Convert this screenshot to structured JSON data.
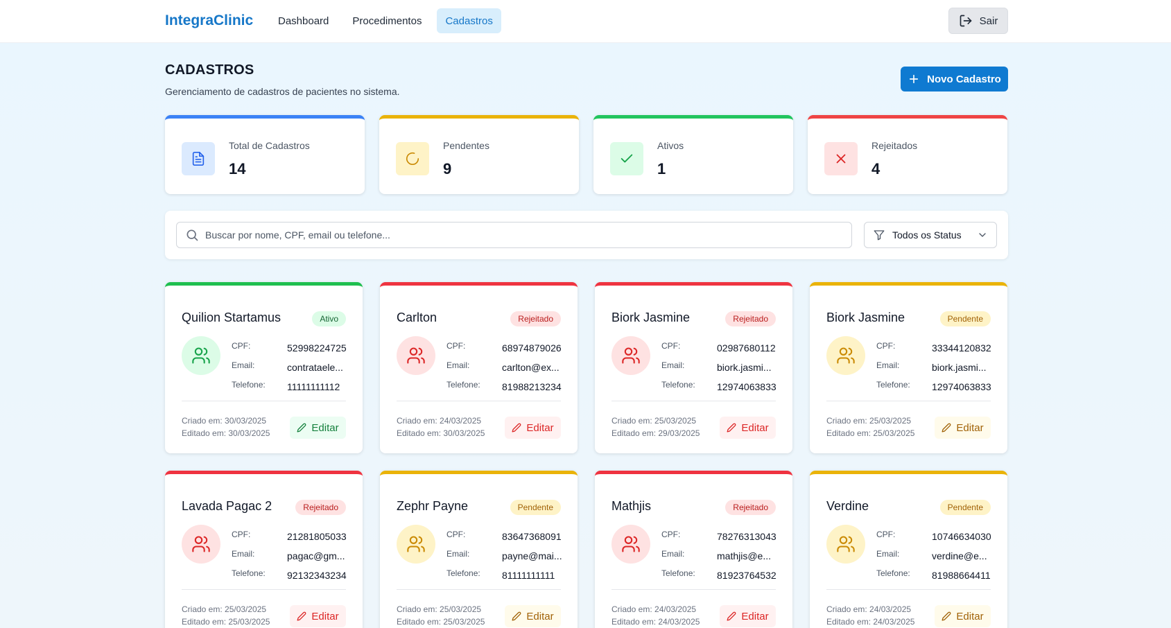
{
  "app": {
    "brand": "IntegraClinic"
  },
  "nav": {
    "items": [
      {
        "label": "Dashboard",
        "active": false
      },
      {
        "label": "Procedimentos",
        "active": false
      },
      {
        "label": "Cadastros",
        "active": true
      }
    ],
    "logout_label": "Sair"
  },
  "header": {
    "title": "CADASTROS",
    "subtitle": "Gerenciamento de cadastros de pacientes no sistema.",
    "new_button_label": "Novo Cadastro"
  },
  "stats": [
    {
      "label": "Total de Cadastros",
      "value": "14",
      "accent": "#3b82f6",
      "icon": "document-icon"
    },
    {
      "label": "Pendentes",
      "value": "9",
      "accent": "#eab308",
      "icon": "loader-icon"
    },
    {
      "label": "Ativos",
      "value": "1",
      "accent": "#22c55e",
      "icon": "check-icon"
    },
    {
      "label": "Rejeitados",
      "value": "4",
      "accent": "#ef4444",
      "icon": "x-icon"
    }
  ],
  "filters": {
    "search_placeholder": "Buscar por nome, CPF, email ou telefone...",
    "status_selected": "Todos os Status"
  },
  "card_labels": {
    "cpf": "CPF:",
    "email": "Email:",
    "telefone": "Telefone:",
    "edit": "Editar"
  },
  "patients": [
    {
      "name": "Quilion Startamus",
      "status": "Ativo",
      "status_key": "ativo",
      "cpf": "52998224725",
      "email": "contrataele...",
      "telefone": "11111111112",
      "created": "Criado em: 30/03/2025",
      "edited": "Editado em: 30/03/2025"
    },
    {
      "name": "Carlton",
      "status": "Rejeitado",
      "status_key": "rejeitado",
      "cpf": "68974879026",
      "email": "carlton@ex...",
      "telefone": "81988213234",
      "created": "Criado em: 24/03/2025",
      "edited": "Editado em: 30/03/2025"
    },
    {
      "name": "Biork Jasmine",
      "status": "Rejeitado",
      "status_key": "rejeitado",
      "cpf": "02987680112",
      "email": "biork.jasmi...",
      "telefone": "12974063833",
      "created": "Criado em: 25/03/2025",
      "edited": "Editado em: 29/03/2025"
    },
    {
      "name": "Biork Jasmine",
      "status": "Pendente",
      "status_key": "pendente",
      "cpf": "33344120832",
      "email": "biork.jasmi...",
      "telefone": "12974063833",
      "created": "Criado em: 25/03/2025",
      "edited": "Editado em: 25/03/2025"
    },
    {
      "name": "Lavada Pagac 2",
      "status": "Rejeitado",
      "status_key": "rejeitado",
      "cpf": "21281805033",
      "email": "pagac@gm...",
      "telefone": "92132343234",
      "created": "Criado em: 25/03/2025",
      "edited": "Editado em: 25/03/2025"
    },
    {
      "name": "Zephr Payne",
      "status": "Pendente",
      "status_key": "pendente",
      "cpf": "83647368091",
      "email": "payne@mai...",
      "telefone": "81111111111",
      "created": "Criado em: 25/03/2025",
      "edited": "Editado em: 25/03/2025"
    },
    {
      "name": "Mathjis",
      "status": "Rejeitado",
      "status_key": "rejeitado",
      "cpf": "78276313043",
      "email": "mathjis@e...",
      "telefone": "81923764532",
      "created": "Criado em: 24/03/2025",
      "edited": "Editado em: 24/03/2025"
    },
    {
      "name": "Verdine",
      "status": "Pendente",
      "status_key": "pendente",
      "cpf": "10746634030",
      "email": "verdine@e...",
      "telefone": "81988664411",
      "created": "Criado em: 24/03/2025",
      "edited": "Editado em: 24/03/2025"
    }
  ]
}
